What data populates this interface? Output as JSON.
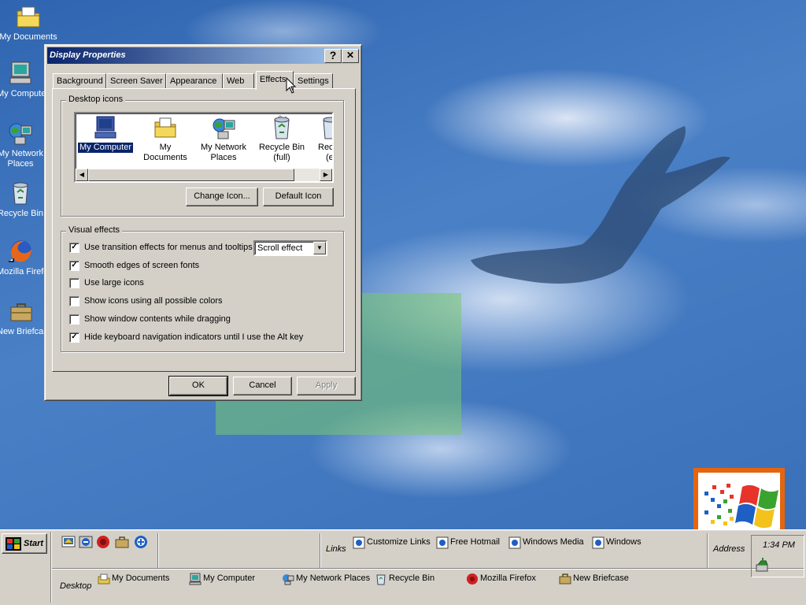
{
  "desktop": {
    "icons": [
      {
        "label": "My Documents",
        "icon": "my-documents-icon"
      },
      {
        "label": "My Computer",
        "icon": "my-computer-icon"
      },
      {
        "label": "My Network Places",
        "icon": "network-places-icon"
      },
      {
        "label": "Recycle Bin",
        "icon": "recycle-bin-icon"
      },
      {
        "label": "Mozilla Firefox",
        "icon": "firefox-icon"
      },
      {
        "label": "New Briefcase",
        "icon": "briefcase-icon"
      }
    ]
  },
  "dialog": {
    "title": "Display Properties",
    "help_button": "?",
    "close_button": "✕",
    "tabs": [
      "Background",
      "Screen Saver",
      "Appearance",
      "Web",
      "Effects",
      "Settings"
    ],
    "active_tab": "Effects",
    "desktop_icons_group": {
      "legend": "Desktop icons",
      "items": [
        {
          "label": "My Computer",
          "selected": true
        },
        {
          "label": "My Documents"
        },
        {
          "label_line1": "My Network",
          "label_line2": "Places"
        },
        {
          "label_line1": "Recycle Bin",
          "label_line2": "(full)"
        },
        {
          "label_line1": "Rec",
          "label_line2": "(e"
        }
      ],
      "change_icon_button": "Change Icon...",
      "default_icon_button": "Default Icon"
    },
    "visual_effects_group": {
      "legend": "Visual effects",
      "options": [
        {
          "label": "Use transition effects for menus and tooltips",
          "checked": true
        },
        {
          "label": "Smooth edges of screen fonts",
          "checked": true
        },
        {
          "label": "Use large icons",
          "checked": false
        },
        {
          "label": "Show icons using all possible colors",
          "checked": false
        },
        {
          "label": "Show window contents while dragging",
          "checked": false
        },
        {
          "label": "Hide keyboard navigation indicators until I use the Alt key",
          "checked": true
        }
      ],
      "transition_select_value": "Scroll effect"
    },
    "ok_button": "OK",
    "cancel_button": "Cancel",
    "apply_button": "Apply"
  },
  "taskbar": {
    "start_label": "Start",
    "quick_launch": [
      "show-desktop-icon",
      "internet-explorer-icon",
      "outlook-icon",
      "briefcase-icon",
      "windows-update-icon"
    ],
    "links_label": "Links",
    "links": [
      "Customize Links",
      "Free Hotmail",
      "Windows Media",
      "Windows"
    ],
    "address_label": "Address",
    "desktop_label": "Desktop",
    "desktop_items": [
      "My Documents",
      "My Computer",
      "My Network Places",
      "Recycle Bin",
      "Mozilla Firefox",
      "New Briefcase"
    ],
    "clock": "1:34 PM",
    "tray_icon": "safely-remove-hardware-icon"
  },
  "colors": {
    "window_face": "#d4d0c8",
    "title_start": "#0a246a",
    "title_end": "#a6caf0",
    "desktop_blue": "#3a6ea5"
  }
}
